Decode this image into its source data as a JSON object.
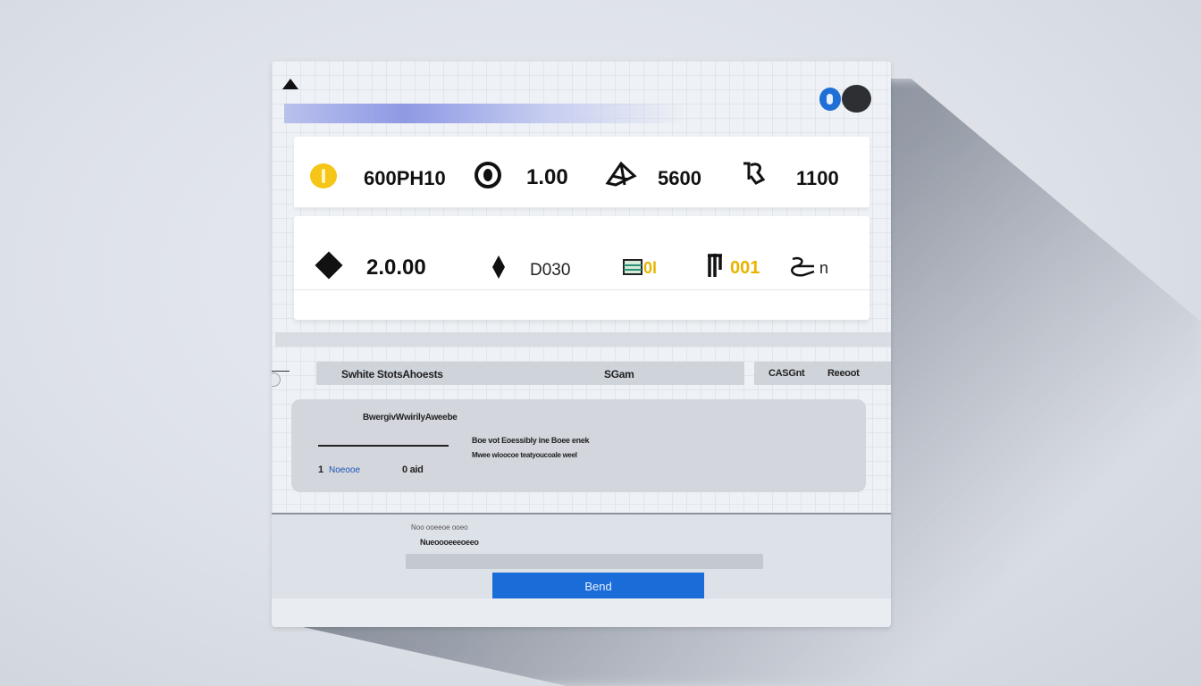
{
  "stats_row1": [
    {
      "icon": "coin-icon",
      "value": "600PH10"
    },
    {
      "icon": "ring-icon",
      "value": "1.00"
    },
    {
      "icon": "sketch-icon",
      "value": "5600"
    },
    {
      "icon": "hand-icon",
      "value": "1100"
    }
  ],
  "stats_row2": [
    {
      "icon": "diamond-icon",
      "value": "2.0.00"
    },
    {
      "icon": "thin-diamond-icon",
      "value": "D030"
    },
    {
      "icon": "card-icon",
      "value": "0l"
    },
    {
      "icon": "tool-icon",
      "value": "001"
    },
    {
      "icon": "scribble-icon",
      "value": "n"
    }
  ],
  "filter": {
    "left_label": "Swhite StotsAhoests",
    "search_label": "SGam",
    "right_label_1": "CASGnt",
    "right_label_2": "Reeoot"
  },
  "panel": {
    "heading": "BwergivWwirilyAweebe",
    "line1": "Boe vot Eoessibly ine Boee enek",
    "line2": "Mwee wioocoe teatyoucoale weel",
    "count": "1",
    "link": "Noeooe",
    "amount": "0 aid"
  },
  "composer": {
    "caption": "Noo ooeeoe ooeo",
    "item": "Nueoooeeeoeeo",
    "send_label": "Bend"
  },
  "colors": {
    "accent": "#1a6cd8",
    "coin": "#f5c518",
    "gradient": "#8e99e4"
  }
}
